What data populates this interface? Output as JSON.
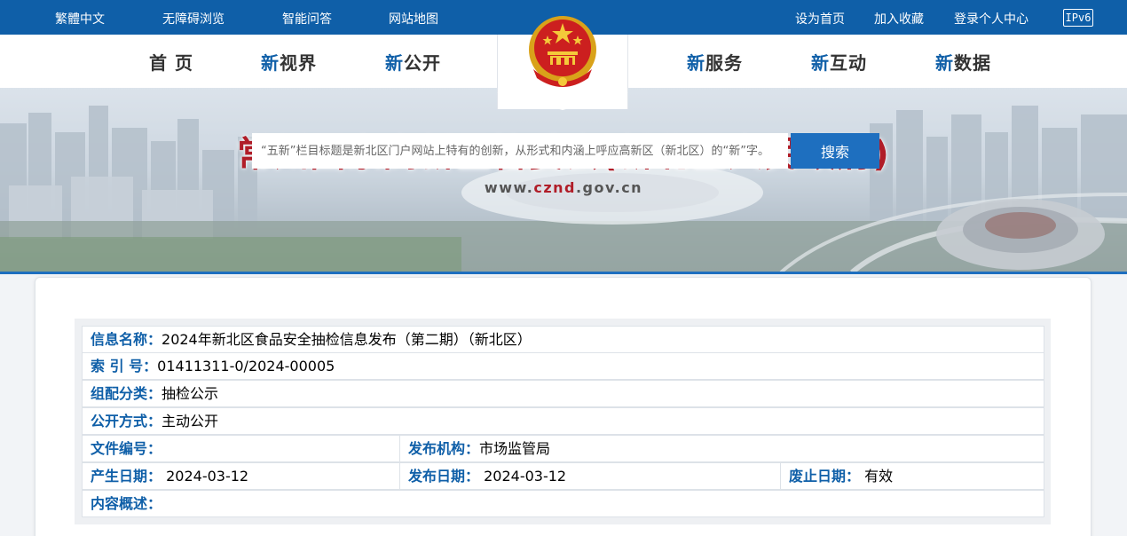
{
  "topbar": {
    "links": [
      "繁體中文",
      "无障碍浏览",
      "智能问答",
      "网站地图"
    ],
    "right_links": [
      "设为首页",
      "加入收藏",
      "登录个人中心"
    ],
    "ipv6": "IPv6"
  },
  "nav": {
    "items": [
      {
        "prefix": "",
        "text": "首 页"
      },
      {
        "prefix": "新",
        "text": "视界"
      },
      {
        "prefix": "新",
        "text": "公开"
      },
      {
        "prefix": "新",
        "text": "服务"
      },
      {
        "prefix": "新",
        "text": "互动"
      },
      {
        "prefix": "新",
        "text": "数据"
      }
    ]
  },
  "banner": {
    "title": "常州国家高新区管委会(新北区人民政府)",
    "url_prefix": "www.",
    "url_strong": "cznd",
    "url_suffix": ".gov.cn"
  },
  "search": {
    "placeholder": "“五新”栏目标题是新北区门户网站上特有的创新，从形式和内涵上呼应高新区（新北区）的“新”字。",
    "button": "搜索"
  },
  "meta": {
    "info_name_label": "信息名称：",
    "info_name_value": "2024年新北区食品安全抽检信息发布（第二期）（新北区）",
    "index_label": "索 引 号：",
    "index_value": "01411311-0/2024-00005",
    "category_label": "组配分类：",
    "category_value": "抽检公示",
    "open_label": "公开方式：",
    "open_value": "主动公开",
    "doc_no_label": "文件编号：",
    "doc_no_value": "",
    "publisher_label": "发布机构：",
    "publisher_value": "市场监管局",
    "created_label": "产生日期：",
    "created_value": "2024-03-12",
    "published_label": "发布日期：",
    "published_value": "2024-03-12",
    "expire_label": "废止日期：",
    "expire_value": "有效",
    "summary_label": "内容概述：",
    "summary_value": ""
  },
  "colors": {
    "brand_blue": "#0f5fa8",
    "title_red": "#b01d28",
    "button_blue": "#1e6fbf"
  }
}
